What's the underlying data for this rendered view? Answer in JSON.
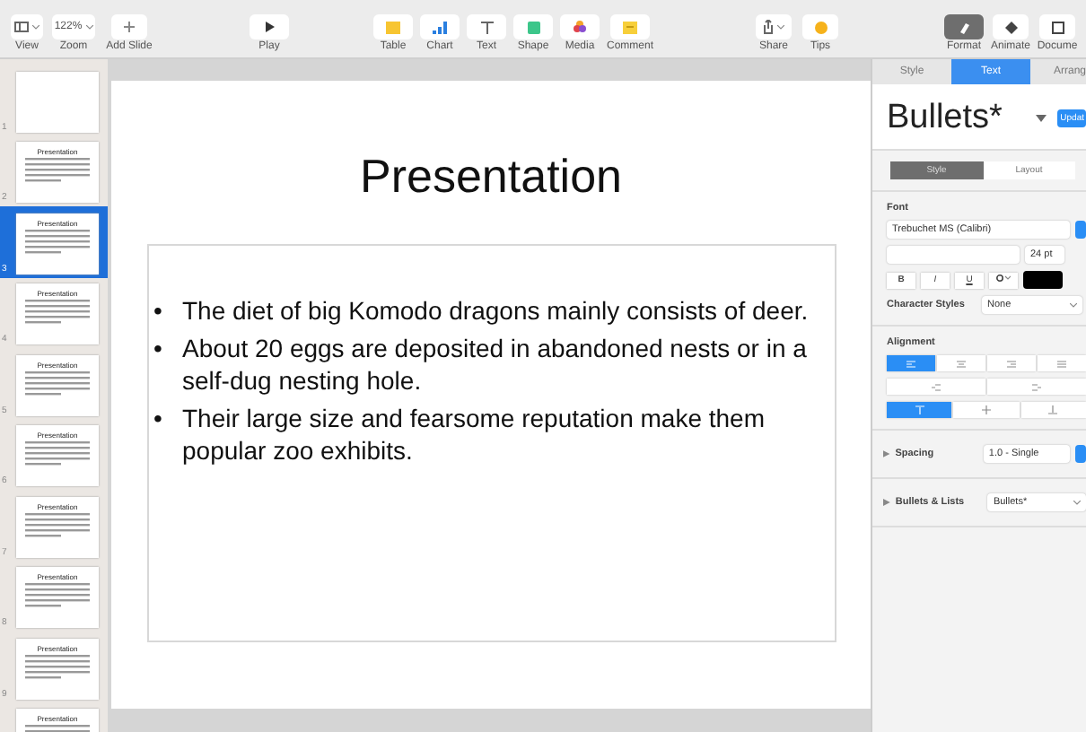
{
  "toolbar": {
    "items": [
      {
        "kind": "view",
        "label": "View"
      },
      {
        "kind": "zoom",
        "label": "Zoom",
        "value": "122%"
      },
      {
        "kind": "add",
        "label": "Add Slide"
      },
      {
        "kind": "play",
        "label": "Play"
      },
      {
        "kind": "table",
        "label": "Table"
      },
      {
        "kind": "chart",
        "label": "Chart"
      },
      {
        "kind": "text",
        "label": "Text"
      },
      {
        "kind": "shape",
        "label": "Shape"
      },
      {
        "kind": "media",
        "label": "Media"
      },
      {
        "kind": "comment",
        "label": "Comment"
      },
      {
        "kind": "share",
        "label": "Share"
      },
      {
        "kind": "tips",
        "label": "Tips"
      },
      {
        "kind": "format",
        "label": "Format",
        "selected": true
      },
      {
        "kind": "animate",
        "label": "Animate",
        "selected": false
      },
      {
        "kind": "document",
        "label": "Docume",
        "selected": false
      }
    ]
  },
  "navigator": {
    "slides": [
      {
        "number": "1",
        "selected": false
      },
      {
        "number": "2",
        "title": "Presentation",
        "selected": false
      },
      {
        "number": "3",
        "title": "Presentation",
        "selected": true
      },
      {
        "number": "4",
        "title": "Presentation",
        "selected": false
      },
      {
        "number": "5",
        "title": "Presentation",
        "selected": false
      },
      {
        "number": "6",
        "title": "Presentation",
        "selected": false
      },
      {
        "number": "7",
        "title": "Presentation",
        "selected": false
      },
      {
        "number": "8",
        "title": "Presentation",
        "selected": false
      },
      {
        "number": "9",
        "title": "Presentation",
        "selected": false
      },
      {
        "title": "Presentation",
        "selected": false
      }
    ]
  },
  "slide": {
    "title": "Presentation",
    "bullets": [
      {
        "marker": "•",
        "text": "The diet of big Komodo dragons mainly consists of deer."
      },
      {
        "marker": "•",
        "text": "About 20 eggs are deposited in abandoned nests or in a self-dug nesting hole."
      },
      {
        "marker": "•",
        "text": "Their large size and fearsome reputation make them popular zoo exhibits."
      }
    ]
  },
  "inspector": {
    "tabs": [
      {
        "label": "Style",
        "selected": false
      },
      {
        "label": "Text",
        "selected": true
      },
      {
        "label": "Arrang",
        "selected": false
      }
    ],
    "style_name": "Bullets*",
    "update_button": "Updat",
    "segments": [
      {
        "label": "Style",
        "selected": true
      },
      {
        "label": "Layout",
        "selected": false
      }
    ],
    "font": {
      "label": "Font",
      "family": "Trebuchet MS (Calibri)",
      "size": "24 pt",
      "styles": [
        "B",
        "I",
        "U"
      ],
      "color": "#000000"
    },
    "character_styles": {
      "label": "Character Styles",
      "value": "None"
    },
    "alignment": {
      "label": "Alignment",
      "horizontal": [
        {
          "kind": "left",
          "selected": true
        },
        {
          "kind": "center",
          "selected": false
        },
        {
          "kind": "right",
          "selected": false
        },
        {
          "kind": "justify",
          "selected": false
        }
      ],
      "vertical": [
        {
          "kind": "top",
          "selected": true
        },
        {
          "kind": "middle",
          "selected": false
        },
        {
          "kind": "bottom",
          "selected": false
        }
      ]
    },
    "spacing": {
      "label": "Spacing",
      "value": "1.0 - Single"
    },
    "bullets": {
      "label": "Bullets & Lists",
      "value": "Bullets*"
    }
  }
}
